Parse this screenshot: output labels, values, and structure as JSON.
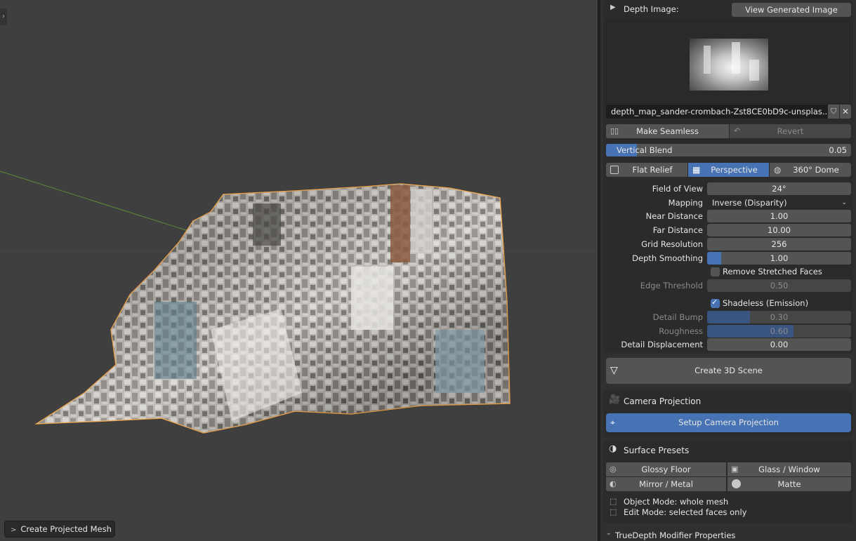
{
  "viewport": {
    "operator_panel_label": "Create Projected Mesh",
    "expand_glyph": "›"
  },
  "depth_image": {
    "header_label": "Depth Image:",
    "view_button": "View Generated Image",
    "filename": "depth_map_sander-crombach-Zst8CE0bD9c-unsplas...",
    "make_seamless": "Make Seamless",
    "revert": "Revert",
    "vertical_blend_label": "Vertical Blend",
    "vertical_blend_value": "0.05",
    "vertical_blend_fraction": 0.05
  },
  "projection_modes": {
    "flat_relief": "Flat Relief",
    "perspective": "Perspective",
    "dome": "360° Dome",
    "selected": "Perspective"
  },
  "params": {
    "fov_label": "Field of View",
    "fov_value": "24°",
    "mapping_label": "Mapping",
    "mapping_value": "Inverse (Disparity)",
    "near_label": "Near Distance",
    "near_value": "1.00",
    "far_label": "Far Distance",
    "far_value": "10.00",
    "grid_label": "Grid Resolution",
    "grid_value": "256",
    "smooth_label": "Depth Smoothing",
    "smooth_value": "1.00",
    "smooth_fraction": 0.1,
    "remove_stretched_label": "Remove Stretched Faces",
    "remove_stretched_checked": false,
    "edge_label": "Edge Threshold",
    "edge_value": "0.50",
    "shadeless_label": "Shadeless (Emission)",
    "shadeless_checked": true,
    "bump_label": "Detail Bump",
    "bump_value": "0.30",
    "bump_fraction": 0.3,
    "rough_label": "Roughness",
    "rough_value": "0.60",
    "rough_fraction": 0.6,
    "disp_label": "Detail Displacement",
    "disp_value": "0.00"
  },
  "create_scene_button": "Create 3D Scene",
  "camera_projection": {
    "header": "Camera Projection",
    "setup_button": "Setup Camera Projection"
  },
  "surface_presets": {
    "header": "Surface Presets",
    "glossy_floor": "Glossy Floor",
    "glass_window": "Glass / Window",
    "mirror_metal": "Mirror / Metal",
    "matte": "Matte",
    "hint_object": "Object Mode: whole mesh",
    "hint_edit": "Edit Mode: selected faces only"
  },
  "modifier_panel": {
    "header": "TrueDepth Modifier Properties"
  },
  "colors": {
    "accent": "#4772b3",
    "selection_outline": "#f0a040",
    "panel_bg": "#2b2b2b",
    "viewport_bg": "#3f3f3f"
  }
}
